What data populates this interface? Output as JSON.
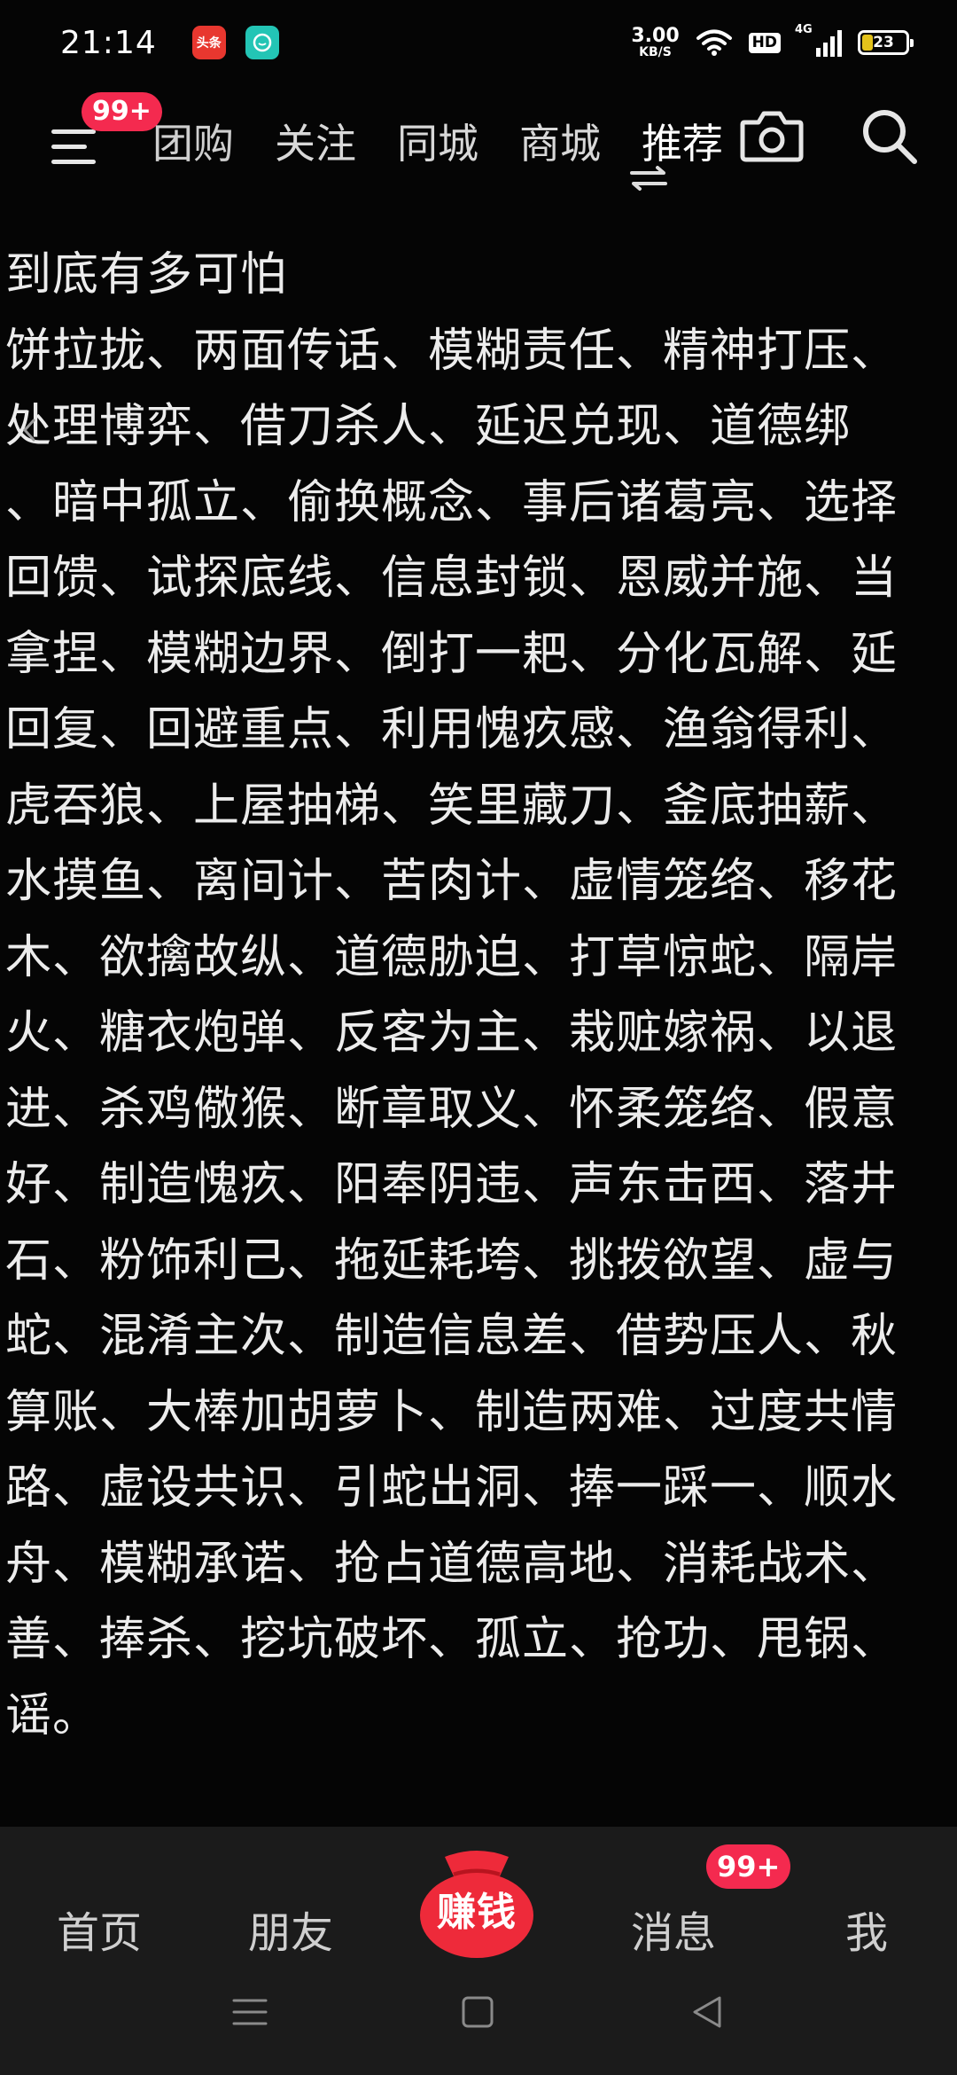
{
  "status_bar": {
    "time": "21:14",
    "app_toutiao": "头条",
    "net_speed_value": "3.00",
    "net_speed_unit": "KB/S",
    "hd": "HD",
    "network": "4G",
    "battery": "23"
  },
  "top_nav": {
    "menu_badge": "99+",
    "tabs": [
      {
        "label": "团购"
      },
      {
        "label": "关注"
      },
      {
        "label": "同城"
      },
      {
        "label": "商城"
      },
      {
        "label": "推荐"
      }
    ]
  },
  "content": {
    "lines": [
      "到底有多可怕",
      "饼拉拢、两面传话、模糊责任、精神打压、",
      "处理博弈、借刀杀人、延迟兑现、道德绑",
      "、暗中孤立、偷换概念、事后诸葛亮、选择",
      "回馈、试探底线、信息封锁、恩威并施、当",
      "拿捏、模糊边界、倒打一耙、分化瓦解、延",
      "回复、回避重点、利用愧疚感、渔翁得利、",
      "虎吞狼、上屋抽梯、笑里藏刀、釜底抽薪、",
      "水摸鱼、离间计、苦肉计、虚情笼络、移花",
      "木、欲擒故纵、道德胁迫、打草惊蛇、隔岸",
      "火、糖衣炮弹、反客为主、栽赃嫁祸、以退",
      "进、杀鸡儆猴、断章取义、怀柔笼络、假意",
      "好、制造愧疚、阳奉阴违、声东击西、落井",
      "石、粉饰利己、拖延耗垮、挑拨欲望、虚与",
      "蛇、混淆主次、制造信息差、借势压人、秋",
      "算账、大棒加胡萝卜、制造两难、过度共情",
      "路、虚设共识、引蛇出洞、捧一踩一、顺水",
      "舟、模糊承诺、抢占道德高地、消耗战术、",
      "善、捧杀、挖坑破坏、孤立、抢功、甩锅、",
      "谣。"
    ]
  },
  "bottom_nav": {
    "home": "首页",
    "friends": "朋友",
    "earn": "赚钱",
    "messages": "消息",
    "messages_badge": "99+",
    "me": "我"
  },
  "colors": {
    "badge": "#f42a4f",
    "earn_button": "#ee2a3a",
    "bottom_bar": "#1b1b1b"
  }
}
